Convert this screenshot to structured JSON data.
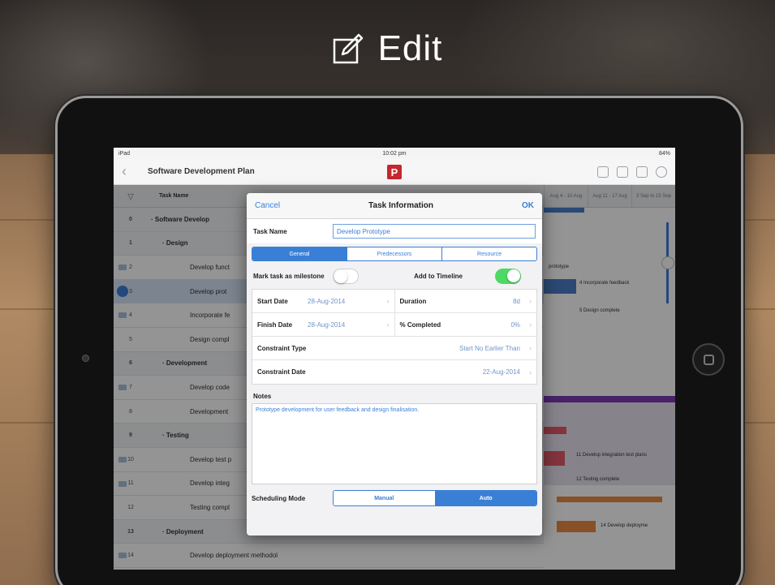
{
  "hero": {
    "title": "Edit",
    "icon": "edit-icon"
  },
  "status_bar": {
    "carrier": "iPad",
    "time": "10:02 pm",
    "battery": "84%"
  },
  "nav": {
    "back_icon": "back-chevron-icon",
    "title": "Software Development Plan",
    "logo_letter": "P"
  },
  "grid": {
    "header_name": "Task Name",
    "timeline_headers": [
      "Aug 4 - 10 Aug",
      "Aug 11 - 17 Aug",
      "3 Sep to 15 Sep"
    ],
    "rows": [
      {
        "num": "0",
        "name": "Software Develop",
        "level": 1,
        "summary": true
      },
      {
        "num": "1",
        "name": "Design",
        "level": 2,
        "summary": true
      },
      {
        "num": "2",
        "name": "Develop funct",
        "level": 3,
        "note": true
      },
      {
        "num": "3",
        "name": "Develop prot",
        "level": 3,
        "selected": true
      },
      {
        "num": "4",
        "name": "Incorporate fe",
        "level": 3,
        "note": true
      },
      {
        "num": "5",
        "name": "Design compl",
        "level": 3
      },
      {
        "num": "6",
        "name": "Development",
        "level": 2,
        "summary": true
      },
      {
        "num": "7",
        "name": "Develop code",
        "level": 3,
        "note": true
      },
      {
        "num": "8",
        "name": "Development",
        "level": 3
      },
      {
        "num": "9",
        "name": "Testing",
        "level": 2,
        "summary": true
      },
      {
        "num": "10",
        "name": "Develop test p",
        "level": 3,
        "note": true
      },
      {
        "num": "11",
        "name": "Develop integ",
        "level": 3,
        "note": true
      },
      {
        "num": "12",
        "name": "Testing compl",
        "level": 3
      },
      {
        "num": "13",
        "name": "Deployment",
        "level": 2,
        "summary": true
      },
      {
        "num": "14",
        "name": "Develop deployment methodology",
        "level": 3,
        "note": true
      }
    ],
    "gantt_labels": {
      "l1": "prototype",
      "l2": "4 Incorporate feedback",
      "l3": "5 Design complete",
      "l4": "11 Develop integration test plans",
      "l5": "12 Testing complete",
      "l6": "14 Develop deployme"
    }
  },
  "modal": {
    "cancel": "Cancel",
    "title": "Task Information",
    "ok": "OK",
    "task_name_label": "Task Name",
    "task_name_value": "Develop Prototype",
    "tabs": [
      "General",
      "Predecessors",
      "Resource"
    ],
    "active_tab": "General",
    "milestone_label": "Mark task as milestone",
    "milestone_on": false,
    "timeline_label": "Add to Timeline",
    "timeline_on": true,
    "start_date_label": "Start Date",
    "start_date": "28-Aug-2014",
    "duration_label": "Duration",
    "duration": "8d",
    "finish_date_label": "Finish Date",
    "finish_date": "28-Aug-2014",
    "completed_label": "% Completed",
    "completed": "0%",
    "constraint_type_label": "Constraint Type",
    "constraint_type": "Start No Earlier Than",
    "constraint_date_label": "Constraint Date",
    "constraint_date": "22-Aug-2014",
    "notes_label": "Notes",
    "notes": "Prototype development for user feedback and design finalisation.",
    "scheduling_label": "Scheduling Mode",
    "scheduling_options": [
      "Manual",
      "Auto"
    ],
    "scheduling_active": "Auto"
  },
  "colors": {
    "accent": "#3a7fd6",
    "toggle_on": "#4cd964",
    "logo": "#c6262e",
    "summary_bar": "#7b3bb5"
  }
}
